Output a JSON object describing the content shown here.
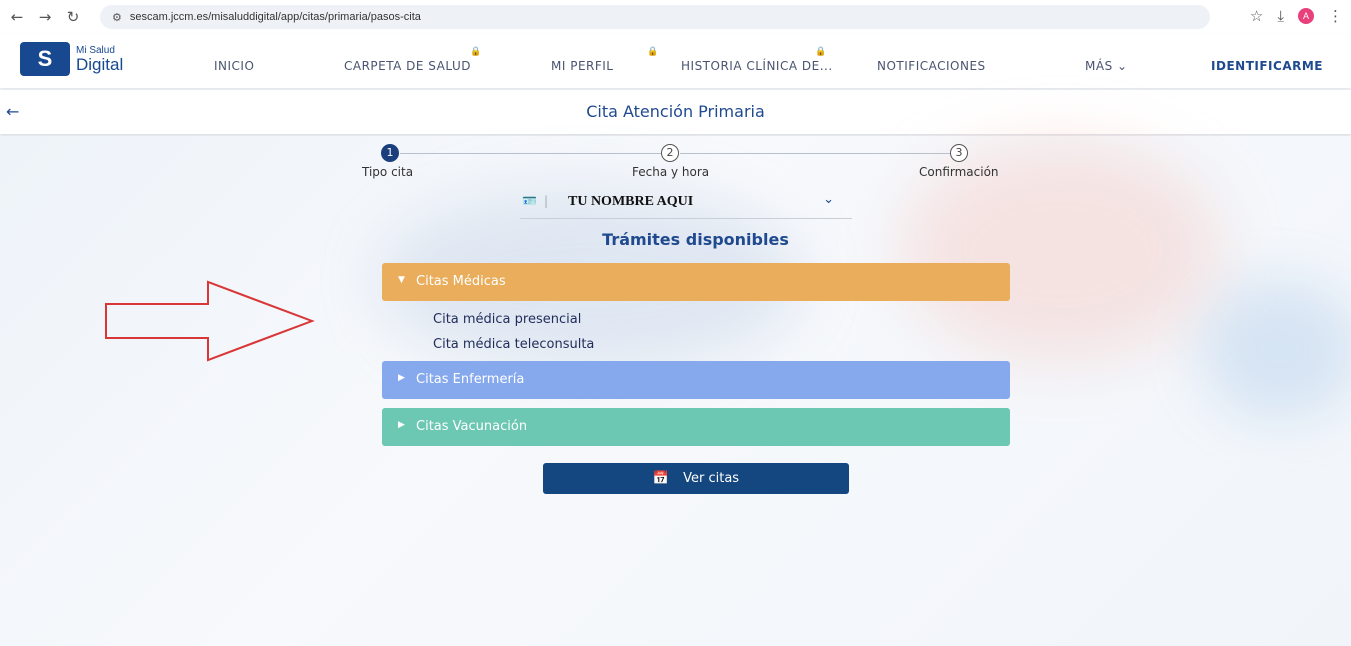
{
  "browser": {
    "url": "sescam.jccm.es/misaluddigital/app/citas/primaria/pasos-cita",
    "profile_initial": "A"
  },
  "header": {
    "logo_small": "Mi Salud",
    "logo_big": "Digital",
    "logo_mark": "S",
    "nav": [
      {
        "label": "INICIO",
        "locked": false
      },
      {
        "label": "CARPETA DE SALUD",
        "locked": true
      },
      {
        "label": "MI PERFIL",
        "locked": true
      },
      {
        "label": "HISTORIA CLÍNICA DE...",
        "locked": true
      },
      {
        "label": "NOTIFICACIONES",
        "locked": false
      },
      {
        "label": "MÁS",
        "locked": false
      }
    ],
    "login": "IDENTIFICARME"
  },
  "page": {
    "title": "Cita Atención Primaria"
  },
  "stepper": {
    "steps": [
      {
        "number": "1",
        "label": "Tipo cita",
        "active": true
      },
      {
        "number": "2",
        "label": "Fecha y hora",
        "active": false
      },
      {
        "number": "3",
        "label": "Confirmación",
        "active": false
      }
    ]
  },
  "patient": {
    "name": "TU NOMBRE AQUI"
  },
  "tramites": {
    "title": "Trámites disponibles",
    "sections": [
      {
        "label": "Citas Médicas",
        "color": "#e9ad5b",
        "expanded": true,
        "items": [
          "Cita médica presencial",
          "Cita médica teleconsulta"
        ]
      },
      {
        "label": "Citas Enfermería",
        "color": "#86a9ee",
        "expanded": false,
        "items": []
      },
      {
        "label": "Citas Vacunación",
        "color": "#6cc8b3",
        "expanded": false,
        "items": []
      }
    ]
  },
  "actions": {
    "ver_citas": "Ver citas"
  },
  "colors": {
    "primary": "#1f4a8f",
    "button": "#14467f",
    "annotation_arrow": "#d93636"
  }
}
